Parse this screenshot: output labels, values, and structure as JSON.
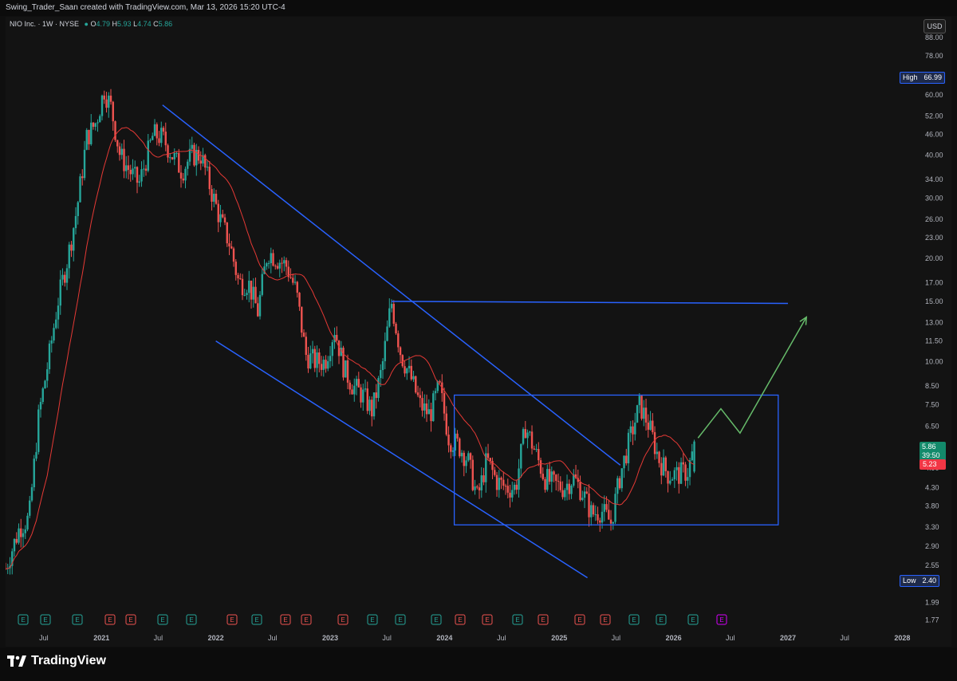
{
  "header": {
    "attribution": "Swing_Trader_Saan created with TradingView.com, Mar 13, 2026 15:20 UTC-4"
  },
  "legend": {
    "symbol": "NIO Inc. · 1W · NYSE",
    "o_label": "O",
    "o_value": "4.79",
    "h_label": "H",
    "h_value": "5.93",
    "l_label": "L",
    "l_value": "4.74",
    "c_label": "C",
    "c_value": "5.86"
  },
  "currency_button": "USD",
  "tags": {
    "high_label": "High",
    "high_value": "66.99",
    "low_label": "Low",
    "low_value": "2.40",
    "last_price": "5.86",
    "countdown": "39:50",
    "ma_value": "5.23"
  },
  "brand": "TradingView",
  "colors": {
    "up": "#26a69a",
    "down": "#ef5350",
    "ma": "#e53935",
    "drawing": "#2962ff",
    "projection": "#66bb6a",
    "background": "#131313"
  },
  "chart_data": {
    "type": "candlestick",
    "symbol": "NIO",
    "interval": "1W",
    "y_scale": "log",
    "ylim": [
      1.7,
      90
    ],
    "y_ticks": [
      "88.00",
      "78.00",
      "60.00",
      "52.00",
      "46.00",
      "40.00",
      "34.00",
      "30.00",
      "26.00",
      "23.00",
      "20.00",
      "17.00",
      "15.00",
      "13.00",
      "11.50",
      "10.00",
      "8.50",
      "7.50",
      "6.50",
      "4.90",
      "4.30",
      "3.80",
      "3.30",
      "2.90",
      "2.55",
      "1.99",
      "1.77"
    ],
    "x_ticks": [
      "Jul",
      "2021",
      "Jul",
      "2022",
      "Jul",
      "2023",
      "Jul",
      "2024",
      "Jul",
      "2025",
      "Jul",
      "2026",
      "Jul",
      "2027",
      "Jul",
      "2028"
    ],
    "x_range": [
      "2020-03",
      "2028-03"
    ],
    "price_path": [
      [
        "2020-03-01",
        2.5
      ],
      [
        "2020-04-15",
        3.3
      ],
      [
        "2020-05-15",
        3.5
      ],
      [
        "2020-06-15",
        7.0
      ],
      [
        "2020-07-15",
        10.0
      ],
      [
        "2020-08-15",
        15.0
      ],
      [
        "2020-09-15",
        20.0
      ],
      [
        "2020-10-15",
        28.0
      ],
      [
        "2020-11-15",
        45.0
      ],
      [
        "2020-12-15",
        50.0
      ],
      [
        "2021-01-10",
        62.0
      ],
      [
        "2021-02-01",
        55.0
      ],
      [
        "2021-03-01",
        40.0
      ],
      [
        "2021-04-01",
        36.0
      ],
      [
        "2021-05-01",
        33.0
      ],
      [
        "2021-06-15",
        46.0
      ],
      [
        "2021-07-15",
        45.0
      ],
      [
        "2021-08-15",
        40.0
      ],
      [
        "2021-09-15",
        36.0
      ],
      [
        "2021-10-15",
        40.0
      ],
      [
        "2021-11-15",
        40.0
      ],
      [
        "2021-12-15",
        32.0
      ],
      [
        "2022-01-15",
        26.0
      ],
      [
        "2022-02-15",
        22.0
      ],
      [
        "2022-03-15",
        17.0
      ],
      [
        "2022-04-15",
        17.0
      ],
      [
        "2022-05-15",
        14.0
      ],
      [
        "2022-06-15",
        21.0
      ],
      [
        "2022-07-15",
        20.0
      ],
      [
        "2022-08-15",
        19.0
      ],
      [
        "2022-09-15",
        16.0
      ],
      [
        "2022-10-15",
        10.5
      ],
      [
        "2022-11-15",
        10.0
      ],
      [
        "2022-12-15",
        10.0
      ],
      [
        "2023-01-15",
        12.5
      ],
      [
        "2023-02-15",
        9.5
      ],
      [
        "2023-03-15",
        8.5
      ],
      [
        "2023-04-15",
        8.0
      ],
      [
        "2023-05-15",
        7.2
      ],
      [
        "2023-06-15",
        9.5
      ],
      [
        "2023-07-15",
        15.0
      ],
      [
        "2023-08-15",
        10.5
      ],
      [
        "2023-09-15",
        9.0
      ],
      [
        "2023-10-15",
        7.5
      ],
      [
        "2023-11-15",
        7.0
      ],
      [
        "2023-12-15",
        8.5
      ],
      [
        "2024-01-15",
        6.0
      ],
      [
        "2024-02-15",
        5.7
      ],
      [
        "2024-03-15",
        5.2
      ],
      [
        "2024-04-15",
        4.0
      ],
      [
        "2024-05-15",
        5.2
      ],
      [
        "2024-06-15",
        4.5
      ],
      [
        "2024-07-15",
        4.3
      ],
      [
        "2024-08-15",
        4.3
      ],
      [
        "2024-09-15",
        6.5
      ],
      [
        "2024-10-15",
        5.5
      ],
      [
        "2024-11-15",
        4.6
      ],
      [
        "2024-12-15",
        4.4
      ],
      [
        "2025-01-15",
        4.3
      ],
      [
        "2025-02-15",
        4.6
      ],
      [
        "2025-03-15",
        4.2
      ],
      [
        "2025-04-15",
        3.6
      ],
      [
        "2025-05-15",
        3.7
      ],
      [
        "2025-06-15",
        3.4
      ],
      [
        "2025-07-15",
        4.7
      ],
      [
        "2025-08-15",
        6.0
      ],
      [
        "2025-09-15",
        7.5
      ],
      [
        "2025-10-15",
        6.5
      ],
      [
        "2025-11-15",
        5.2
      ],
      [
        "2025-12-15",
        4.7
      ],
      [
        "2026-01-15",
        4.7
      ],
      [
        "2026-02-15",
        4.8
      ],
      [
        "2026-03-13",
        5.86
      ]
    ],
    "last": {
      "open": 4.79,
      "high": 5.93,
      "low": 4.74,
      "close": 5.86
    },
    "all_time_high": 66.99,
    "all_time_low": 2.4,
    "moving_average_last": 5.23,
    "earnings_markers": [
      "E",
      "E",
      "E",
      "E",
      "E",
      "E",
      "E",
      "E",
      "E",
      "E",
      "E",
      "E",
      "E",
      "E",
      "E",
      "E",
      "E",
      "E",
      "E",
      "E",
      "E",
      "E",
      "E",
      "E",
      "E",
      "E"
    ],
    "drawings": [
      {
        "type": "trendline",
        "from": [
          "2021-07-15",
          56.0
        ],
        "to": [
          "2025-07-15",
          5.0
        ],
        "label": ""
      },
      {
        "type": "trendline",
        "from": [
          "2022-01-01",
          11.5
        ],
        "to": [
          "2025-04-01",
          2.35
        ],
        "label": ""
      },
      {
        "type": "horizontal",
        "from": [
          "2023-07-15",
          15.0
        ],
        "to": [
          "2027-01-01",
          14.8
        ],
        "label": ""
      },
      {
        "type": "rectangle",
        "from": [
          "2024-02-01",
          8.0
        ],
        "to": [
          "2026-12-01",
          3.35
        ],
        "label": ""
      },
      {
        "type": "projection",
        "points": [
          [
            "2026-03-20",
            6.0
          ],
          [
            "2026-06-01",
            7.3
          ],
          [
            "2026-08-01",
            6.2
          ],
          [
            "2027-03-01",
            13.5
          ]
        ],
        "label": ""
      }
    ]
  }
}
